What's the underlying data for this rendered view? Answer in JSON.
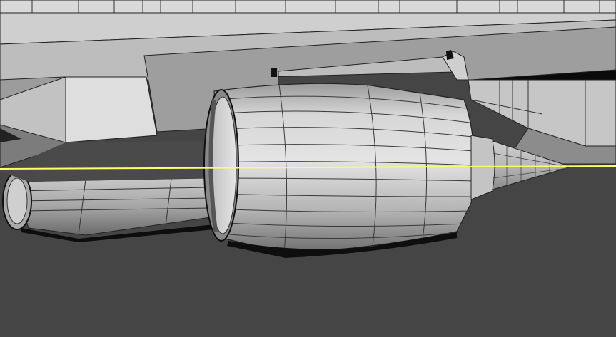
{
  "viewport": {
    "background_color": "#454545",
    "mesh_color": "#c8c8c8",
    "wireframe_color": "#1a1a1a",
    "selection_line_color": "#ffff66",
    "shading": "smooth-with-wireframe"
  },
  "scene": {
    "objects": [
      {
        "name": "aircraft-wing",
        "type": "mesh"
      },
      {
        "name": "wing-pylon",
        "type": "mesh"
      },
      {
        "name": "jet-engine-nacelle",
        "type": "mesh"
      },
      {
        "name": "exhaust-cone",
        "type": "mesh"
      },
      {
        "name": "rear-engine-nacelle",
        "type": "mesh"
      }
    ],
    "selection_line": "horizontal-edge"
  }
}
